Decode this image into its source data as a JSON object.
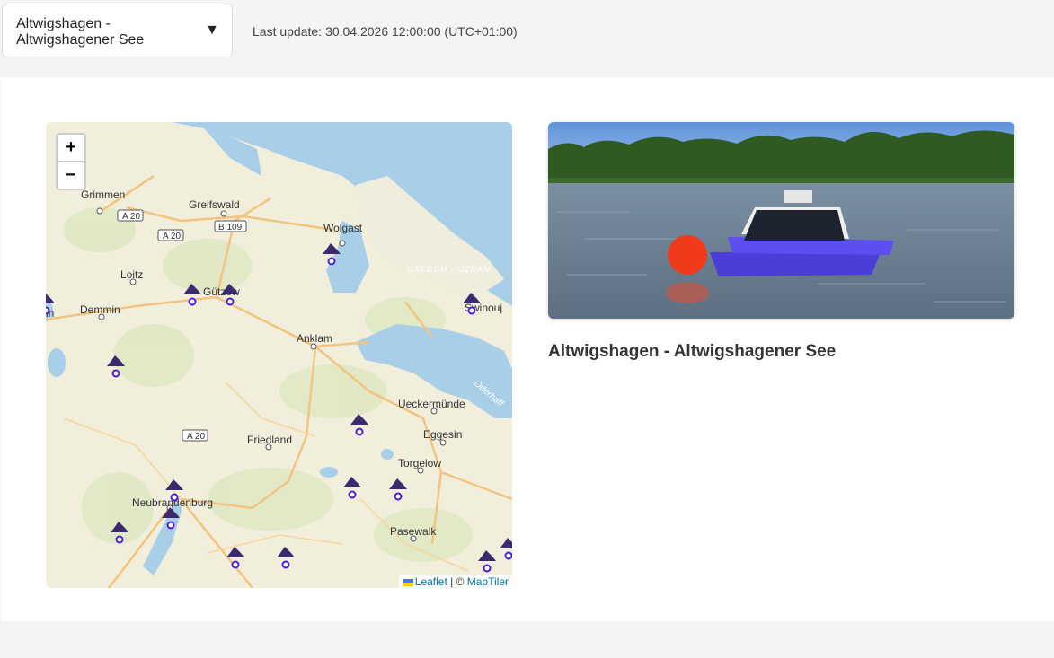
{
  "station_select": {
    "selected": "Altwigshagen - Altwigshagener See",
    "arrow": "▼"
  },
  "last_update": {
    "label": "Last update:",
    "value": "30.04.2026 12:00:00 (UTC+01:00)"
  },
  "map": {
    "zoom_in": "+",
    "zoom_out": "−",
    "attribution": {
      "leaflet": "Leaflet",
      "separator": " | © ",
      "provider": "MapTiler"
    },
    "place_labels": {
      "grimmen": "Grimmen",
      "greifswald": "Greifswald",
      "wolgast": "Wolgast",
      "loitz": "Loitz",
      "guetzow": "Gützow",
      "demmin": "Demmin",
      "anklam": "Anklam",
      "ueckermuende": "Ueckermünde",
      "eggesin": "Eggesin",
      "friedland": "Friedland",
      "torgelow": "Torgelow",
      "neubrandenburg": "Neubrandenburg",
      "pasewalk": "Pasewalk",
      "swinoujscie": "Świnouj",
      "usedom": "USEDOM - UZNAM",
      "oderhaff": "Oderhaff",
      "partial_left": "in"
    },
    "road_labels": {
      "a20_1": "A 20",
      "a20_2": "A 20",
      "b109": "B 109",
      "a20_3": "A 20"
    },
    "marker_icon": "water-buoy-marker-icon"
  },
  "station": {
    "title": "Altwigshagen - Altwigshagener See",
    "photo_alt": "Monitoring buoy on lake"
  }
}
